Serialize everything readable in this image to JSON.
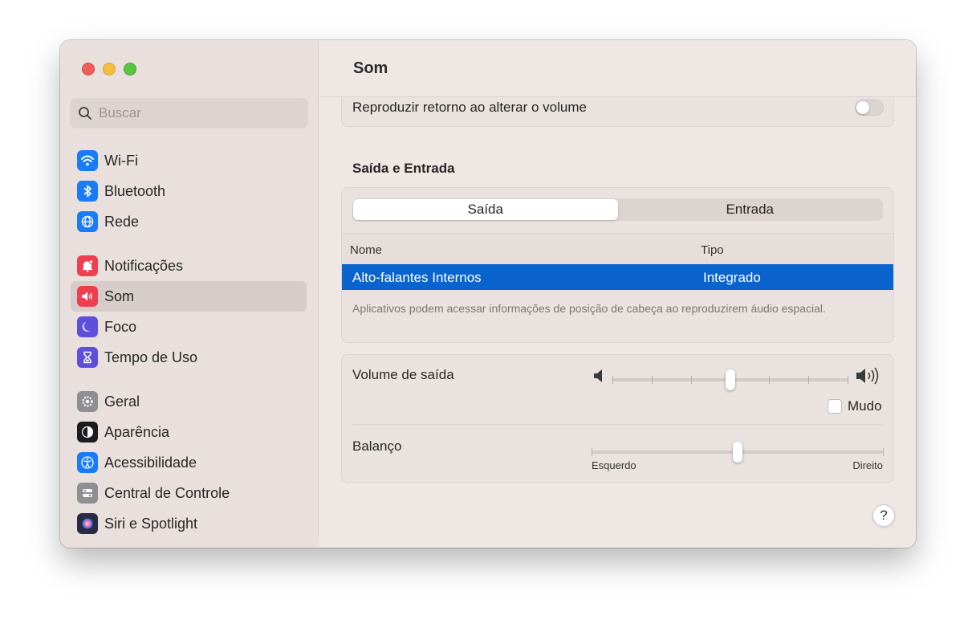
{
  "window": {
    "title": "Som"
  },
  "search": {
    "placeholder": "Buscar"
  },
  "sidebar": {
    "groups": [
      [
        {
          "label": "Wi-Fi",
          "icon": "wifi-icon",
          "color": "#1a7cf5"
        },
        {
          "label": "Bluetooth",
          "icon": "bluetooth-icon",
          "color": "#1a7cf5"
        },
        {
          "label": "Rede",
          "icon": "globe-icon",
          "color": "#1a7cf5"
        }
      ],
      [
        {
          "label": "Notificações",
          "icon": "bell-icon",
          "color": "#ee3e4f"
        },
        {
          "label": "Som",
          "icon": "speaker-icon",
          "color": "#ee3e4f",
          "active": true
        },
        {
          "label": "Foco",
          "icon": "moon-icon",
          "color": "#5e4ed9"
        },
        {
          "label": "Tempo de Uso",
          "icon": "hourglass-icon",
          "color": "#5e4ed9"
        }
      ],
      [
        {
          "label": "Geral",
          "icon": "gear-icon",
          "color": "#8e8e93"
        },
        {
          "label": "Aparência",
          "icon": "appearance-icon",
          "color": "#1c1c1e"
        },
        {
          "label": "Acessibilidade",
          "icon": "accessibility-icon",
          "color": "#1a7cf5"
        },
        {
          "label": "Central de Controle",
          "icon": "control-center-icon",
          "color": "#8e8e93"
        },
        {
          "label": "Siri e Spotlight",
          "icon": "siri-icon",
          "color": "#2a2a44"
        }
      ]
    ]
  },
  "settings": {
    "feedback_label": "Reproduzir retorno ao alterar o volume",
    "feedback_on": false,
    "section_title": "Saída e Entrada",
    "tabs": [
      "Saída",
      "Entrada"
    ],
    "table": {
      "headers": [
        "Nome",
        "Tipo"
      ],
      "rows": [
        [
          "Alto-falantes Internos",
          "Integrado"
        ]
      ]
    },
    "note": "Aplicativos podem acessar informações de posição de cabeça ao reproduzirem áudio espacial.",
    "volume_label": "Volume de saída",
    "volume_level": 0.5,
    "mute_label": "Mudo",
    "mute_checked": false,
    "balance_label": "Balanço",
    "balance_level": 0.5,
    "balance_left": "Esquerdo",
    "balance_right": "Direito"
  },
  "help_label": "?",
  "colors": {
    "accent": "#0b63ce"
  }
}
